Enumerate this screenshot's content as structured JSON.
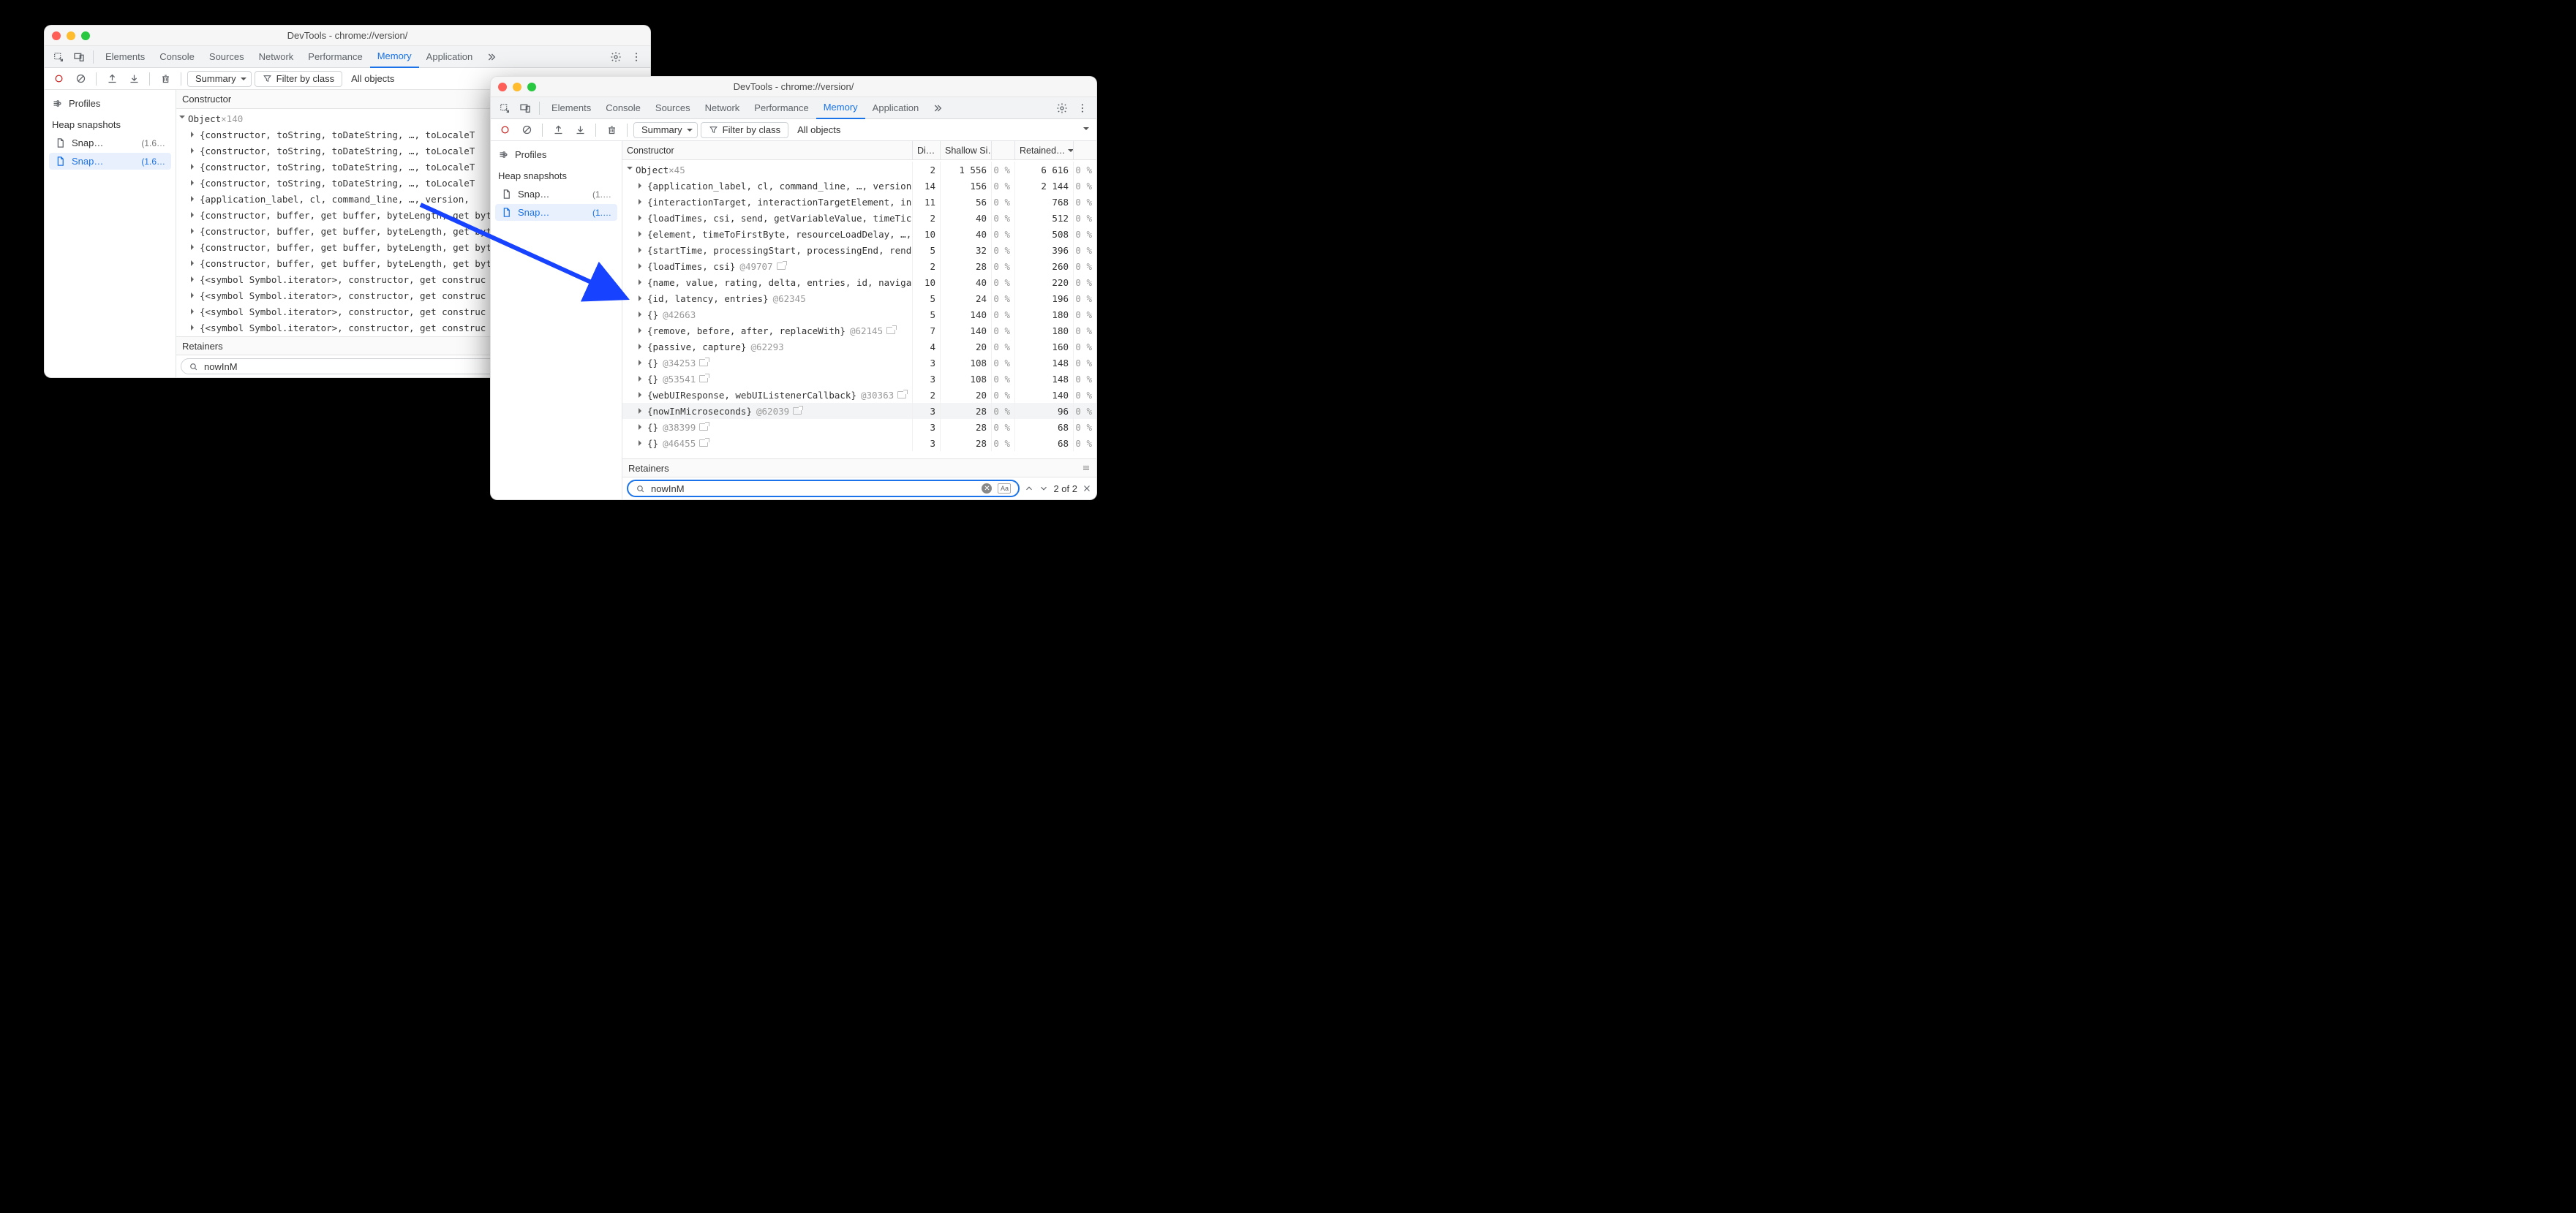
{
  "window_title": "DevTools - chrome://version/",
  "panel_tabs": [
    "Elements",
    "Console",
    "Sources",
    "Network",
    "Performance",
    "Memory",
    "Application"
  ],
  "active_panel": "Memory",
  "toolbar": {
    "summary": "Summary",
    "filter_label": "Filter by class",
    "all_objects": "All objects"
  },
  "sidebar": {
    "profiles": "Profiles",
    "heap_snapshots": "Heap snapshots",
    "snapshots": [
      {
        "name": "Snap…",
        "meta": "(1.6…",
        "selected": false
      },
      {
        "name": "Snap…",
        "meta": "(1.6…",
        "selected": true
      }
    ]
  },
  "sidebar2": {
    "snapshots": [
      {
        "name": "Snap…",
        "meta": "(1.…",
        "selected": false
      },
      {
        "name": "Snap…",
        "meta": "(1.…",
        "selected": true
      }
    ]
  },
  "constructor_label": "Constructor",
  "retainers_label": "Retainers",
  "search_value": "nowInM",
  "search_match": "2 of 2",
  "win1": {
    "root": {
      "label": "Object",
      "count": "×140"
    },
    "rows": [
      "{constructor, toString, toDateString, …, toLocaleT",
      "{constructor, toString, toDateString, …, toLocaleT",
      "{constructor, toString, toDateString, …, toLocaleT",
      "{constructor, toString, toDateString, …, toLocaleT",
      "{application_label, cl, command_line, …, version, ",
      "{constructor, buffer, get buffer, byteLength, get byt",
      "{constructor, buffer, get buffer, byteLength, get byt",
      "{constructor, buffer, get buffer, byteLength, get byt",
      "{constructor, buffer, get buffer, byteLength, get byt",
      "{<symbol Symbol.iterator>, constructor, get construc",
      "{<symbol Symbol.iterator>, constructor, get construc",
      "{<symbol Symbol.iterator>, constructor, get construc",
      "{<symbol Symbol.iterator>, constructor, get construc"
    ]
  },
  "win2": {
    "cols": {
      "constructor": "Constructor",
      "distance": "Di…",
      "shallow": "Shallow Si…",
      "retained": "Retained…"
    },
    "root": {
      "label": "Object",
      "count": "×45",
      "dist": "2",
      "sh": "1 556",
      "sp": "0 %",
      "ret": "6 616",
      "rp": "0 %"
    },
    "rows": [
      {
        "txt": "{application_label, cl, command_line, …, version, v",
        "tag": "",
        "link": false,
        "dist": "14",
        "sh": "156",
        "sp": "0 %",
        "ret": "2 144",
        "rp": "0 %"
      },
      {
        "txt": "{interactionTarget, interactionTargetElement, interac",
        "tag": "",
        "link": false,
        "dist": "11",
        "sh": "56",
        "sp": "0 %",
        "ret": "768",
        "rp": "0 %"
      },
      {
        "txt": "{loadTimes, csi, send, getVariableValue, timeTicks}",
        "tag": "@",
        "link": false,
        "dist": "2",
        "sh": "40",
        "sp": "0 %",
        "ret": "512",
        "rp": "0 %"
      },
      {
        "txt": "{element, timeToFirstByte, resourceLoadDelay, …, el",
        "tag": "",
        "link": false,
        "dist": "10",
        "sh": "40",
        "sp": "0 %",
        "ret": "508",
        "rp": "0 %"
      },
      {
        "txt": "{startTime, processingStart, processingEnd, renderTim",
        "tag": "",
        "link": false,
        "dist": "5",
        "sh": "32",
        "sp": "0 %",
        "ret": "396",
        "rp": "0 %"
      },
      {
        "txt": "{loadTimes, csi}",
        "tag": "@49707",
        "link": true,
        "dist": "2",
        "sh": "28",
        "sp": "0 %",
        "ret": "260",
        "rp": "0 %"
      },
      {
        "txt": "{name, value, rating, delta, entries, id, navigationT",
        "tag": "",
        "link": false,
        "dist": "10",
        "sh": "40",
        "sp": "0 %",
        "ret": "220",
        "rp": "0 %"
      },
      {
        "txt": "{id, latency, entries}",
        "tag": "@62345",
        "link": false,
        "dist": "5",
        "sh": "24",
        "sp": "0 %",
        "ret": "196",
        "rp": "0 %"
      },
      {
        "txt": "{}",
        "tag": "@42663",
        "link": false,
        "dist": "5",
        "sh": "140",
        "sp": "0 %",
        "ret": "180",
        "rp": "0 %"
      },
      {
        "txt": "{remove, before, after, replaceWith}",
        "tag": "@62145",
        "link": true,
        "dist": "7",
        "sh": "140",
        "sp": "0 %",
        "ret": "180",
        "rp": "0 %"
      },
      {
        "txt": "{passive, capture}",
        "tag": "@62293",
        "link": false,
        "dist": "4",
        "sh": "20",
        "sp": "0 %",
        "ret": "160",
        "rp": "0 %"
      },
      {
        "txt": "{}",
        "tag": "@34253",
        "link": true,
        "dist": "3",
        "sh": "108",
        "sp": "0 %",
        "ret": "148",
        "rp": "0 %"
      },
      {
        "txt": "{}",
        "tag": "@53541",
        "link": true,
        "dist": "3",
        "sh": "108",
        "sp": "0 %",
        "ret": "148",
        "rp": "0 %"
      },
      {
        "txt": "{webUIResponse, webUIListenerCallback}",
        "tag": "@30363",
        "link": true,
        "dist": "2",
        "sh": "20",
        "sp": "0 %",
        "ret": "140",
        "rp": "0 %"
      },
      {
        "txt": "{nowInMicroseconds}",
        "tag": "@62039",
        "link": true,
        "hl": true,
        "dist": "3",
        "sh": "28",
        "sp": "0 %",
        "ret": "96",
        "rp": "0 %"
      },
      {
        "txt": "{}",
        "tag": "@38399",
        "link": true,
        "dist": "3",
        "sh": "28",
        "sp": "0 %",
        "ret": "68",
        "rp": "0 %"
      },
      {
        "txt": "{}",
        "tag": "@46455",
        "link": true,
        "dist": "3",
        "sh": "28",
        "sp": "0 %",
        "ret": "68",
        "rp": "0 %"
      }
    ]
  }
}
